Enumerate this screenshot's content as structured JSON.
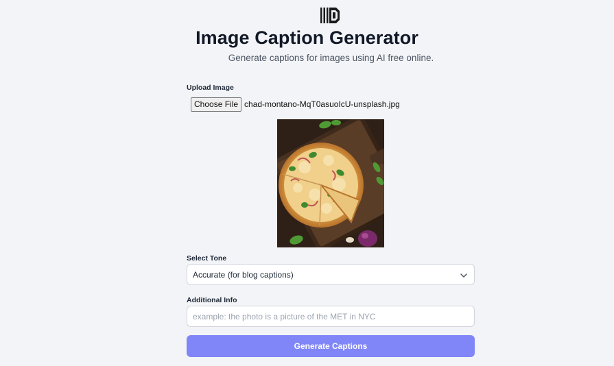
{
  "header": {
    "logo_icon": "logo-icon",
    "title": "Image Caption Generator",
    "subtitle": "Generate captions for images using AI free online."
  },
  "upload": {
    "label": "Upload Image",
    "button_label": "Choose File",
    "file_name": "chad-montano-MqT0asuoIcU-unsplash.jpg",
    "preview_description": "pizza-photo"
  },
  "tone": {
    "label": "Select Tone",
    "selected": "Accurate (for blog captions)",
    "chevron_icon": "chevron-down-icon"
  },
  "info": {
    "label": "Additional Info",
    "value": "",
    "placeholder": "example: the photo is a picture of the MET in NYC"
  },
  "actions": {
    "generate_label": "Generate Captions"
  },
  "colors": {
    "background": "#f3f4f7",
    "accent": "#8086f7",
    "title": "#111827"
  }
}
